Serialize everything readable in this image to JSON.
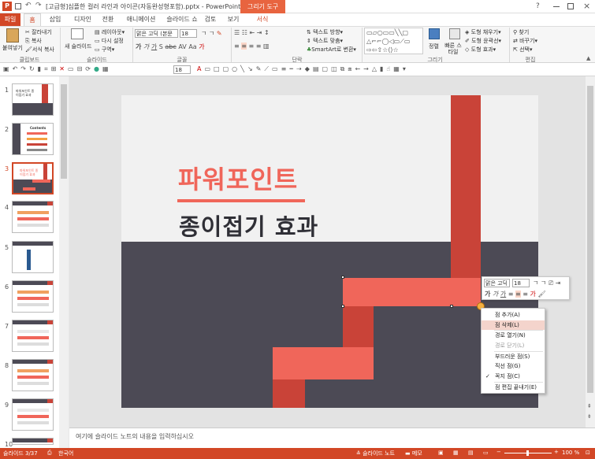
{
  "window": {
    "title": "[고급형]심플한 컬러 라인과 아이콘(자동완성형포함).pptx - PowerPoint",
    "contextual_tab": "그리기 도구",
    "help": "?",
    "logo": "P"
  },
  "tabs": [
    "파일",
    "홈",
    "삽입",
    "디자인",
    "전환",
    "애니메이션",
    "슬라이드 쇼",
    "검토",
    "보기",
    "서식"
  ],
  "ribbon": {
    "paste": "붙여넣기",
    "cut": "잘라내기",
    "copy": "복사",
    "format_painter": "서식 복사",
    "new_slide": "새 슬라이드",
    "layout": "레이아웃",
    "reset": "다시 설정",
    "section": "구역",
    "font_name": "맑은 고딕 (본문",
    "font_size": "18",
    "text_direction": "텍스트 방향",
    "align_text": "텍스트 맞춤",
    "smartart": "SmartArt로 변환",
    "arrange": "정렬",
    "quick_styles": "빠른 스타일",
    "shape_fill": "도형 채우기",
    "shape_outline": "도형 윤곽선",
    "shape_effects": "도형 효과",
    "find": "찾기",
    "replace": "바꾸기",
    "select": "선택",
    "groups": {
      "clipboard": "클립보드",
      "slides": "슬라이드",
      "font": "글꼴",
      "paragraph": "단락",
      "drawing": "그리기",
      "editing": "편집"
    }
  },
  "qat": {
    "font_size": "18"
  },
  "thumbnails": [
    {
      "num": "1",
      "text": "파워포인트 종이접기 효과"
    },
    {
      "num": "2",
      "text": "Contents"
    },
    {
      "num": "3",
      "text": "파워포인트 종이접기 효과"
    },
    {
      "num": "4",
      "text": ""
    },
    {
      "num": "5",
      "text": ""
    },
    {
      "num": "6",
      "text": ""
    },
    {
      "num": "7",
      "text": ""
    },
    {
      "num": "8",
      "text": ""
    },
    {
      "num": "9",
      "text": ""
    },
    {
      "num": "10",
      "text": ""
    }
  ],
  "slide": {
    "title": "파워포인트",
    "subtitle": "종이접기 효과",
    "accent": "#f0665a",
    "dark": "#4c4a55",
    "strip": "#c94338"
  },
  "minitoolbar": {
    "font": "맑은 고딕",
    "size": "18"
  },
  "context_menu": [
    {
      "label": "점 추가(A)",
      "disabled": false,
      "checked": false,
      "highlight": false
    },
    {
      "label": "점 삭제(L)",
      "disabled": false,
      "checked": false,
      "highlight": true
    },
    {
      "label": "경로 열기(N)",
      "disabled": false,
      "checked": false,
      "highlight": false
    },
    {
      "label": "경로 닫기(L)",
      "disabled": true,
      "checked": false,
      "highlight": false
    },
    {
      "label": "부드러운 점(S)",
      "disabled": false,
      "checked": false,
      "highlight": false
    },
    {
      "label": "직선 점(G)",
      "disabled": false,
      "checked": false,
      "highlight": false
    },
    {
      "label": "꼭지 점(C)",
      "disabled": false,
      "checked": true,
      "highlight": false
    },
    {
      "label": "점 편집 끝내기(E)",
      "disabled": false,
      "checked": false,
      "highlight": false
    }
  ],
  "notes_placeholder": "여기에 슬라이드 노트의 내용을 입력하십시오",
  "status": {
    "slide": "슬라이드 3/37",
    "lang": "한국어",
    "notes": "슬라이드 노트",
    "comments": "메모",
    "zoom": "100 %"
  },
  "colors": {
    "brand": "#d24726",
    "ribbon_bg": "#f6f6f6"
  }
}
